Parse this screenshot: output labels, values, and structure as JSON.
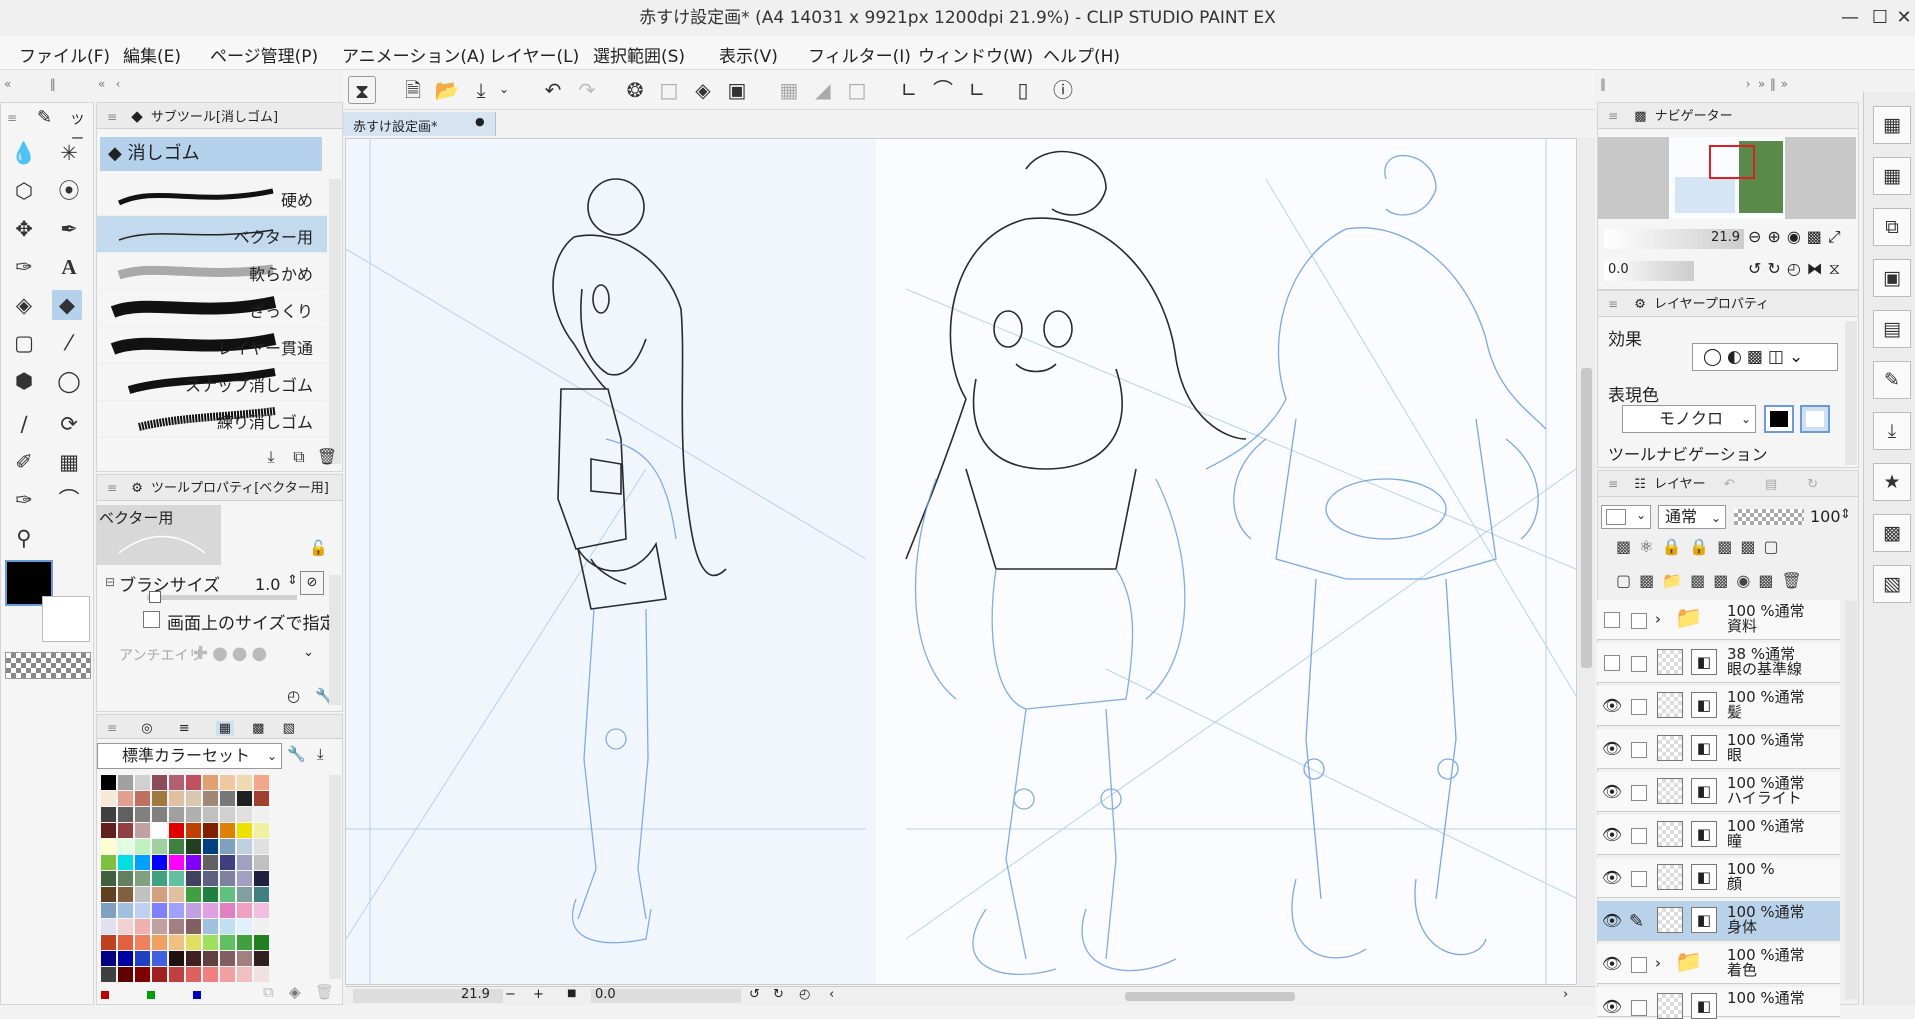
{
  "window": {
    "title": "赤すけ設定画* (A4 14031 x 9921px 1200dpi 21.9%)  - CLIP STUDIO PAINT EX",
    "minimize_icon": "minimize-icon",
    "maximize_icon": "maximize-icon",
    "close_icon": "close-icon"
  },
  "menu": [
    "ファイル(F)",
    "編集(E)",
    "ページ管理(P)",
    "アニメーション(A)",
    "レイヤー(L)",
    "選択範囲(S)",
    "表示(V)",
    "フィルター(I)",
    "ウィンドウ(W)",
    "ヘルプ(H)"
  ],
  "tool_panel": {
    "tab_label": "ツー",
    "tools": [
      "blend-icon",
      "sparkle-icon",
      "object-select-icon",
      "lasso-icon",
      "move-icon",
      "pen-nib-icon",
      "pen-icon",
      "text-icon",
      "fill-icon",
      "eraser-icon",
      "gradient-icon",
      "line-icon",
      "figure-icon",
      "balloon-icon",
      "eyedropper-icon",
      "rotate-icon",
      "marker-icon",
      "stamp-icon",
      "brush-icon",
      "smudge-icon",
      "zoom-icon"
    ]
  },
  "subtool": {
    "title": "サブツール[消しゴム]",
    "group": "消しゴム",
    "items": [
      "硬め",
      "ベクター用",
      "軟らかめ",
      "ざっくり",
      "レイヤー貫通",
      "スナップ消しゴム",
      "練り消しゴム"
    ]
  },
  "tool_property": {
    "title": "ツールプロパティ[ベクター用]",
    "preset": "ベクター用",
    "brush_size_label": "ブラシサイズ",
    "brush_size_value": "1.0",
    "screen_size_label": "画面上のサイズで指定",
    "antialias_label": "アンチエイリ"
  },
  "color_set": {
    "name": "標準カラーセット",
    "colors": [
      [
        "#000000",
        "#a0a0a0",
        "#d0d0d0",
        "#8c4a5a",
        "#b06070",
        "#c05060",
        "#e0a070",
        "#f0c8a0",
        "#f0d8b0",
        "#f0a888"
      ],
      [
        "#f8e8d8",
        "#e0a090",
        "#c07060",
        "#a07840",
        "#e0c0a0",
        "#d8c8b0",
        "#a08878",
        "#787878",
        "#202020",
        "#a04030"
      ],
      [
        "#404040",
        "#606060",
        "#808080",
        "#808080",
        "#a0a0a0",
        "#b0b0b0",
        "#c0c0c0",
        "#d0d0d0",
        "#e0e0e0",
        "#f0f0f0"
      ],
      [
        "#602020",
        "#904040",
        "#c0a0a0",
        "#ffffff",
        "#e00000",
        "#c04000",
        "#802000",
        "#e08000",
        "#f0e000",
        "#f0f0a0"
      ],
      [
        "#ffffd0",
        "#e0ffe0",
        "#c0f0c0",
        "#a0d0a0",
        "#408040",
        "#204020",
        "#004080",
        "#80a0c0",
        "#c0d0e0",
        "#e0e0e0"
      ],
      [
        "#80c040",
        "#00e0e0",
        "#00a0ff",
        "#0000ff",
        "#ff00ff",
        "#8000ff",
        "#606060",
        "#404080",
        "#a0a0c0",
        "#c0c0c0"
      ],
      [
        "#406040",
        "#608060",
        "#80a080",
        "#40a080",
        "#60c0a0",
        "#404060",
        "#606080",
        "#8080a0",
        "#a0a0c0",
        "#202040"
      ],
      [
        "#604020",
        "#806040",
        "#c0c0c0",
        "#d0a080",
        "#e0c0a0",
        "#40a040",
        "#208040",
        "#60c080",
        "#80a0a0",
        "#408080"
      ],
      [
        "#80a0c0",
        "#a0c0e0",
        "#c0d0f0",
        "#8080ff",
        "#a0a0ff",
        "#c0a0e0",
        "#e0a0e0",
        "#e080c0",
        "#f0a0c0",
        "#f0c0e0"
      ],
      [
        "#e0e0f0",
        "#f0d0d0",
        "#f0b0b0",
        "#c0a0a0",
        "#a08080",
        "#806060",
        "#a0c0e0",
        "#c0e0f0",
        "#e0f0ff",
        "#f0f0f0"
      ],
      [
        "#c04020",
        "#e06040",
        "#f08060",
        "#f0a060",
        "#f0c080",
        "#e0e060",
        "#a0e060",
        "#60c060",
        "#40a040",
        "#208020"
      ],
      [
        "#000080",
        "#0000a0",
        "#2040c0",
        "#4060e0",
        "#201010",
        "#402020",
        "#604040",
        "#806060",
        "#a08080",
        "#302020"
      ],
      [
        "#404040",
        "#600000",
        "#800000",
        "#a02020",
        "#c04040",
        "#e06060",
        "#f08080",
        "#f0a0a0",
        "#f0c0c0",
        "#f0e0e0"
      ]
    ],
    "bottom_dots": [
      "#c00000",
      "#00a000",
      "#0000c0"
    ]
  },
  "canvas": {
    "tab_label": "赤すけ設定画*",
    "zoom": "21.9",
    "rotation": "0.0"
  },
  "navigator": {
    "title": "ナビゲーター",
    "zoom": "21.9",
    "rotation": "0.0"
  },
  "layer_property": {
    "title": "レイヤープロパティ",
    "effect_label": "効果",
    "expression_label": "表現色",
    "expression_value": "モノクロ",
    "tool_nav_label": "ツールナビゲーション"
  },
  "layers_panel": {
    "tab_label": "レイヤー",
    "blend_mode": "通常",
    "opacity": "100",
    "layers": [
      {
        "opacity_mode": "100 %通常",
        "name": "資料",
        "visible": false,
        "folder": true
      },
      {
        "opacity_mode": "38 %通常",
        "name": "眼の基準線",
        "visible": false,
        "folder": false
      },
      {
        "opacity_mode": "100 %通常",
        "name": "髪",
        "visible": true,
        "folder": false
      },
      {
        "opacity_mode": "100 %通常",
        "name": "眼",
        "visible": true,
        "folder": false
      },
      {
        "opacity_mode": "100 %通常",
        "name": "ハイライト",
        "visible": true,
        "folder": false
      },
      {
        "opacity_mode": "100 %通常",
        "name": "瞳",
        "visible": true,
        "folder": false
      },
      {
        "opacity_mode": "100 %",
        "name": "顔",
        "visible": true,
        "folder": false
      },
      {
        "opacity_mode": "100 %通常",
        "name": "身体",
        "visible": true,
        "folder": false,
        "selected": true
      },
      {
        "opacity_mode": "100 %通常",
        "name": "着色",
        "visible": true,
        "folder": true
      },
      {
        "opacity_mode": "100 %通常",
        "name": "",
        "visible": true,
        "folder": false
      }
    ]
  },
  "colors": {
    "accent": "#b6d1ec",
    "sketch_blue": "#6d9fe0",
    "lineart": "#2a2a2a",
    "main_color": "#000000",
    "sub_color": "#ffffff"
  }
}
